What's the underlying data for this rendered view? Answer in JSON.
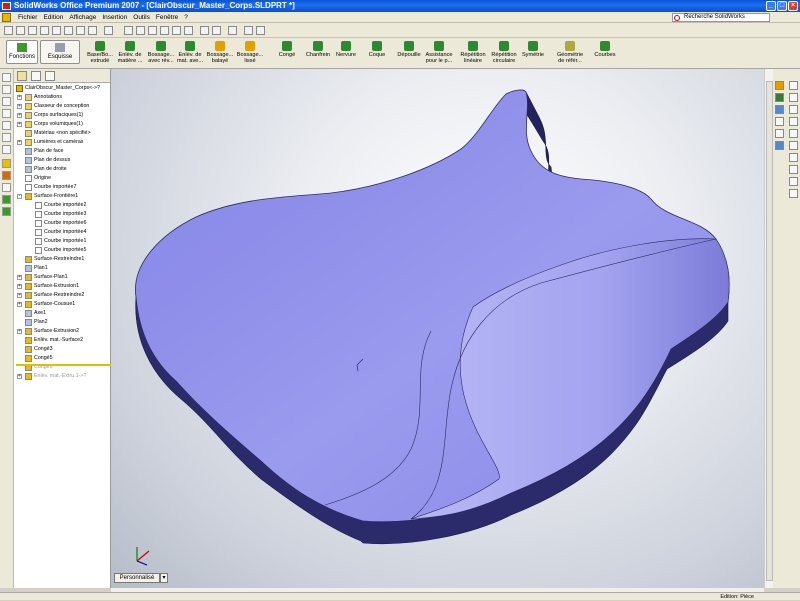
{
  "window": {
    "title": "SolidWorks Office Premium 2007 - [ClairObscur_Master_Corps.SLDPRT *]"
  },
  "menu": {
    "items": [
      "Fichier",
      "Edition",
      "Affichage",
      "Insertion",
      "Outils",
      "Fenêtre",
      "?"
    ]
  },
  "search": {
    "placeholder": "Recherche SolidWorks"
  },
  "command_manager": {
    "tabs": [
      "Fonctions",
      "Esquisse"
    ],
    "commands": [
      "Base/Bo... extrudé",
      "Enlèv. de matière ...",
      "Bossage... avec rév...",
      "Enlèv. de mat. ave...",
      "Bossage... balayé",
      "Bossage... lissé",
      "Congé",
      "Chanfrein",
      "Nervure",
      "Coque",
      "Dépouille",
      "Assistance pour le p...",
      "Répétition linéaire",
      "Répétition circulaire",
      "Symétrie",
      "Géométrie de référ...",
      "Courbes"
    ]
  },
  "feature_tree": {
    "root": "ClairObscur_Master_Corps<->?",
    "items": [
      {
        "label": "Annotations",
        "depth": 1,
        "expander": "+"
      },
      {
        "label": "Classeur de conception",
        "depth": 1,
        "expander": "+"
      },
      {
        "label": "Corps surfaciques(1)",
        "depth": 1,
        "expander": "+"
      },
      {
        "label": "Corps volumiques(1)",
        "depth": 1,
        "expander": "+"
      },
      {
        "label": "Matériau <non spécifié>",
        "depth": 1,
        "expander": ""
      },
      {
        "label": "Lumières et caméras",
        "depth": 1,
        "expander": "+"
      },
      {
        "label": "Plan de face",
        "depth": 1,
        "expander": ""
      },
      {
        "label": "Plan de dessus",
        "depth": 1,
        "expander": ""
      },
      {
        "label": "Plan de droite",
        "depth": 1,
        "expander": ""
      },
      {
        "label": "Origine",
        "depth": 1,
        "expander": ""
      },
      {
        "label": "Courbe importée7",
        "depth": 1,
        "expander": ""
      },
      {
        "label": "Surface-Frontière1",
        "depth": 1,
        "expander": "-"
      },
      {
        "label": "Courbe importée2",
        "depth": 2,
        "expander": ""
      },
      {
        "label": "Courbe importée3",
        "depth": 2,
        "expander": ""
      },
      {
        "label": "Courbe importée6",
        "depth": 2,
        "expander": ""
      },
      {
        "label": "Courbe importée4",
        "depth": 2,
        "expander": ""
      },
      {
        "label": "Courbe importée1",
        "depth": 2,
        "expander": ""
      },
      {
        "label": "Courbe importée5",
        "depth": 2,
        "expander": ""
      },
      {
        "label": "Surface-Restreindre1",
        "depth": 1,
        "expander": ""
      },
      {
        "label": "Plan1",
        "depth": 1,
        "expander": ""
      },
      {
        "label": "Surface-Plan1",
        "depth": 1,
        "expander": "+"
      },
      {
        "label": "Surface-Extrusion1",
        "depth": 1,
        "expander": "+"
      },
      {
        "label": "Surface-Restreindre2",
        "depth": 1,
        "expander": "+"
      },
      {
        "label": "Surface-Cousue1",
        "depth": 1,
        "expander": "+"
      },
      {
        "label": "Axe1",
        "depth": 1,
        "expander": ""
      },
      {
        "label": "Plan2",
        "depth": 1,
        "expander": ""
      },
      {
        "label": "Surface-Extrusion2",
        "depth": 1,
        "expander": "+"
      },
      {
        "label": "Enlèv. mat.-Surface2",
        "depth": 1,
        "expander": ""
      },
      {
        "label": "Congé3",
        "depth": 1,
        "expander": ""
      },
      {
        "label": "Congé5",
        "depth": 1,
        "expander": ""
      },
      {
        "label": "Congé6",
        "depth": 1,
        "expander": "",
        "dim": true
      },
      {
        "label": "Enlèv. mat.-Extru.1->?",
        "depth": 1,
        "expander": "+",
        "dim": true
      }
    ]
  },
  "viewport": {
    "custom_tab": "Personnalisé",
    "part_face_color": "#8c8ce8",
    "part_side_color": "#2a2a6a"
  },
  "status": {
    "text": "Edition: Pièce"
  }
}
